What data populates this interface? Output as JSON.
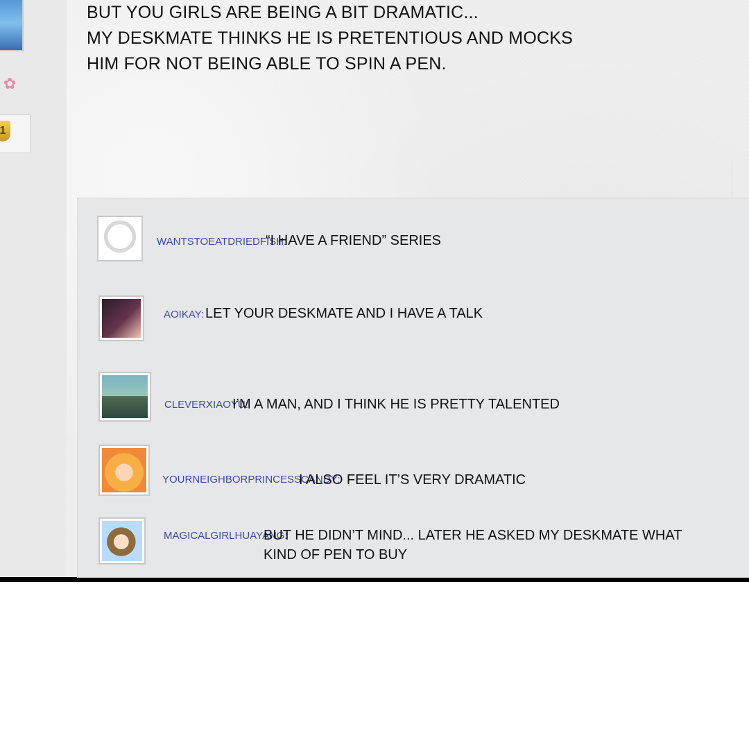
{
  "post": {
    "lines": [
      "BUT YOU GIRLS ARE BEING A BIT DRAMATIC...",
      "MY DESKMATE THINKS HE IS PRETENTIOUS AND MOCKS",
      "HIM FOR NOT BEING ABLE TO SPIN A PEN."
    ]
  },
  "sidebar": {
    "flower_icon": "✿",
    "level_badge": "1",
    "avatar_icon": "user-avatar-icon"
  },
  "comments": [
    {
      "username": "WANTSTOEATDRIEDFISH:",
      "text": "“I HAVE A FRIEND” SERIES",
      "avatar_icon": "white-cat-avatar"
    },
    {
      "username": "AOIKAY:",
      "text": "LET YOUR DESKMATE AND I HAVE A TALK",
      "avatar_icon": "dark-anime-avatar"
    },
    {
      "username": "CLEVERXIAOYU:",
      "text": "I’M A MAN, AND I THINK HE IS PRETTY TALENTED",
      "avatar_icon": "landscape-avatar"
    },
    {
      "username": "YOURNEIGHBORPRINCESSCANDY:",
      "text": "I ALSO FEEL IT’S VERY DRAMATIC",
      "avatar_icon": "blonde-girl-avatar"
    },
    {
      "username": "MAGICALGIRLHUAYANG:",
      "text": "BUT HE DIDN’T MIND... LATER HE ASKED MY DESKMATE WHAT KIND OF PEN TO BUY",
      "avatar_icon": "anime-girl-avatar"
    }
  ],
  "colors": {
    "username": "#3e4aa0",
    "text": "#111111",
    "panel": "#e6e7e9",
    "paper": "#efefef",
    "divider": "#000000"
  }
}
